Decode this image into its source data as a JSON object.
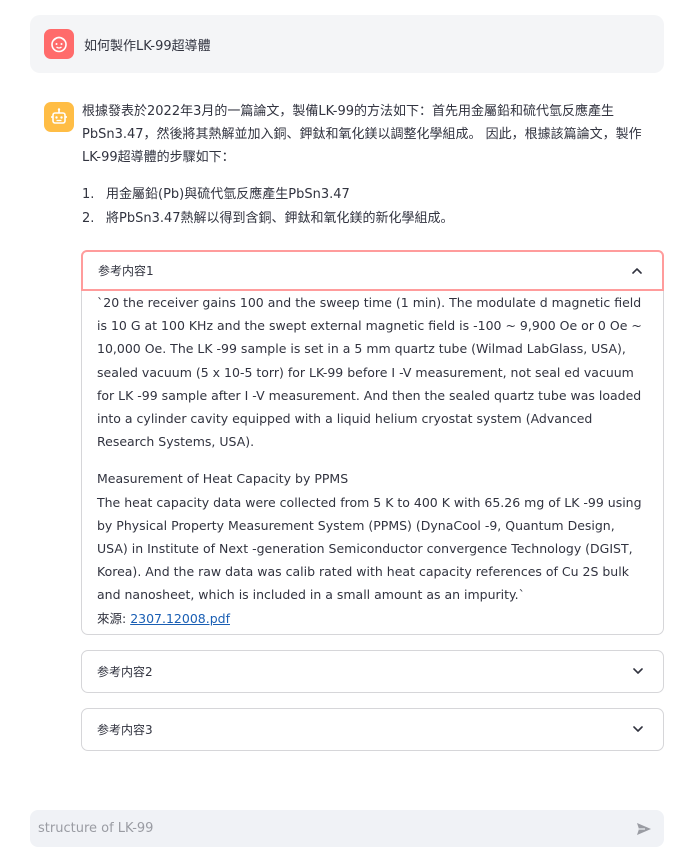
{
  "user_message": {
    "text": "如何製作LK-99超導體"
  },
  "assistant_message": {
    "answer": "根據發表於2022年3月的一篇論文，製備LK-99的方法如下：首先用金屬鉛和硫代氫反應產生PbSn3.47，然後將其熱解並加入銅、鉀鈦和氧化鎂以調整化學組成。 因此，根據該篇論文，製作LK-99超導體的步驟如下：",
    "steps": [
      {
        "num": "1.",
        "text": "用金屬鉛(Pb)與硫代氫反應產生PbSn3.47"
      },
      {
        "num": "2.",
        "text": "將PbSn3.47熱解以得到含銅、鉀鈦和氧化鎂的新化學組成。"
      }
    ]
  },
  "references": [
    {
      "title": "参考内容1",
      "expanded": true,
      "paragraph1": "`20 the receiver gains 100 and the sweep time (1 min). The modulate d magnetic field is 10 G at 100 KHz and the swept external magnetic field is -100 ~ 9,900 Oe or 0 Oe ~ 10,000 Oe. The LK -99 sample is set in a 5 mm quartz tube (Wilmad LabGlass, USA), sealed vacuum (5 x 10-5 torr) for LK-99 before I -V measurement, not seal ed vacuum for LK -99 sample after I -V measurement. And then the sealed quartz tube was loaded into a cylinder cavity equipped with a liquid helium cryostat system (Advanced Research Systems, USA).",
      "heading": "Measurement of Heat Capacity by PPMS",
      "paragraph2": "The heat capacity data were collected from 5 K to 400 K with 65.26 mg of LK -99 using by Physical Property Measurement System (PPMS) (DynaCool -9, Quantum Design, USA) in Institute of Next -generation Semiconductor convergence Technology (DGIST, Korea). And the raw data was calib rated with heat capacity references of Cu 2S bulk and nanosheet, which is included in a small amount as an impurity.`",
      "source_label": "來源: ",
      "source_link": "2307.12008.pdf"
    },
    {
      "title": "参考内容2",
      "expanded": false
    },
    {
      "title": "参考内容3",
      "expanded": false
    }
  ],
  "chat_input": {
    "placeholder": "structure of LK-99"
  }
}
